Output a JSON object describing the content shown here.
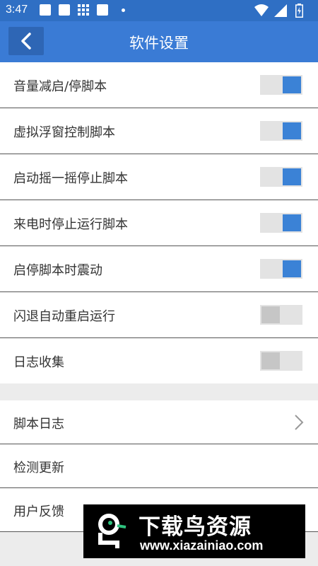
{
  "status_bar": {
    "time": "3:47"
  },
  "header": {
    "title": "软件设置"
  },
  "settings": [
    {
      "label": "音量减启/停脚本",
      "enabled": true
    },
    {
      "label": "虚拟浮窗控制脚本",
      "enabled": true
    },
    {
      "label": "启动摇一摇停止脚本",
      "enabled": true
    },
    {
      "label": "来电时停止运行脚本",
      "enabled": true
    },
    {
      "label": "启停脚本时震动",
      "enabled": true
    },
    {
      "label": "闪退自动重启运行",
      "enabled": false
    },
    {
      "label": "日志收集",
      "enabled": false
    }
  ],
  "menu": [
    {
      "label": "脚本日志",
      "has_chevron": true
    },
    {
      "label": "检测更新",
      "has_chevron": false
    },
    {
      "label": "用户反馈",
      "has_chevron": false
    }
  ],
  "watermark": {
    "title": "下载鸟资源",
    "url": "www.xiazainiao.com"
  },
  "colors": {
    "header": "#3a7bd5",
    "toggle_on": "#3b82d6",
    "toggle_off": "#c6c6c6"
  }
}
